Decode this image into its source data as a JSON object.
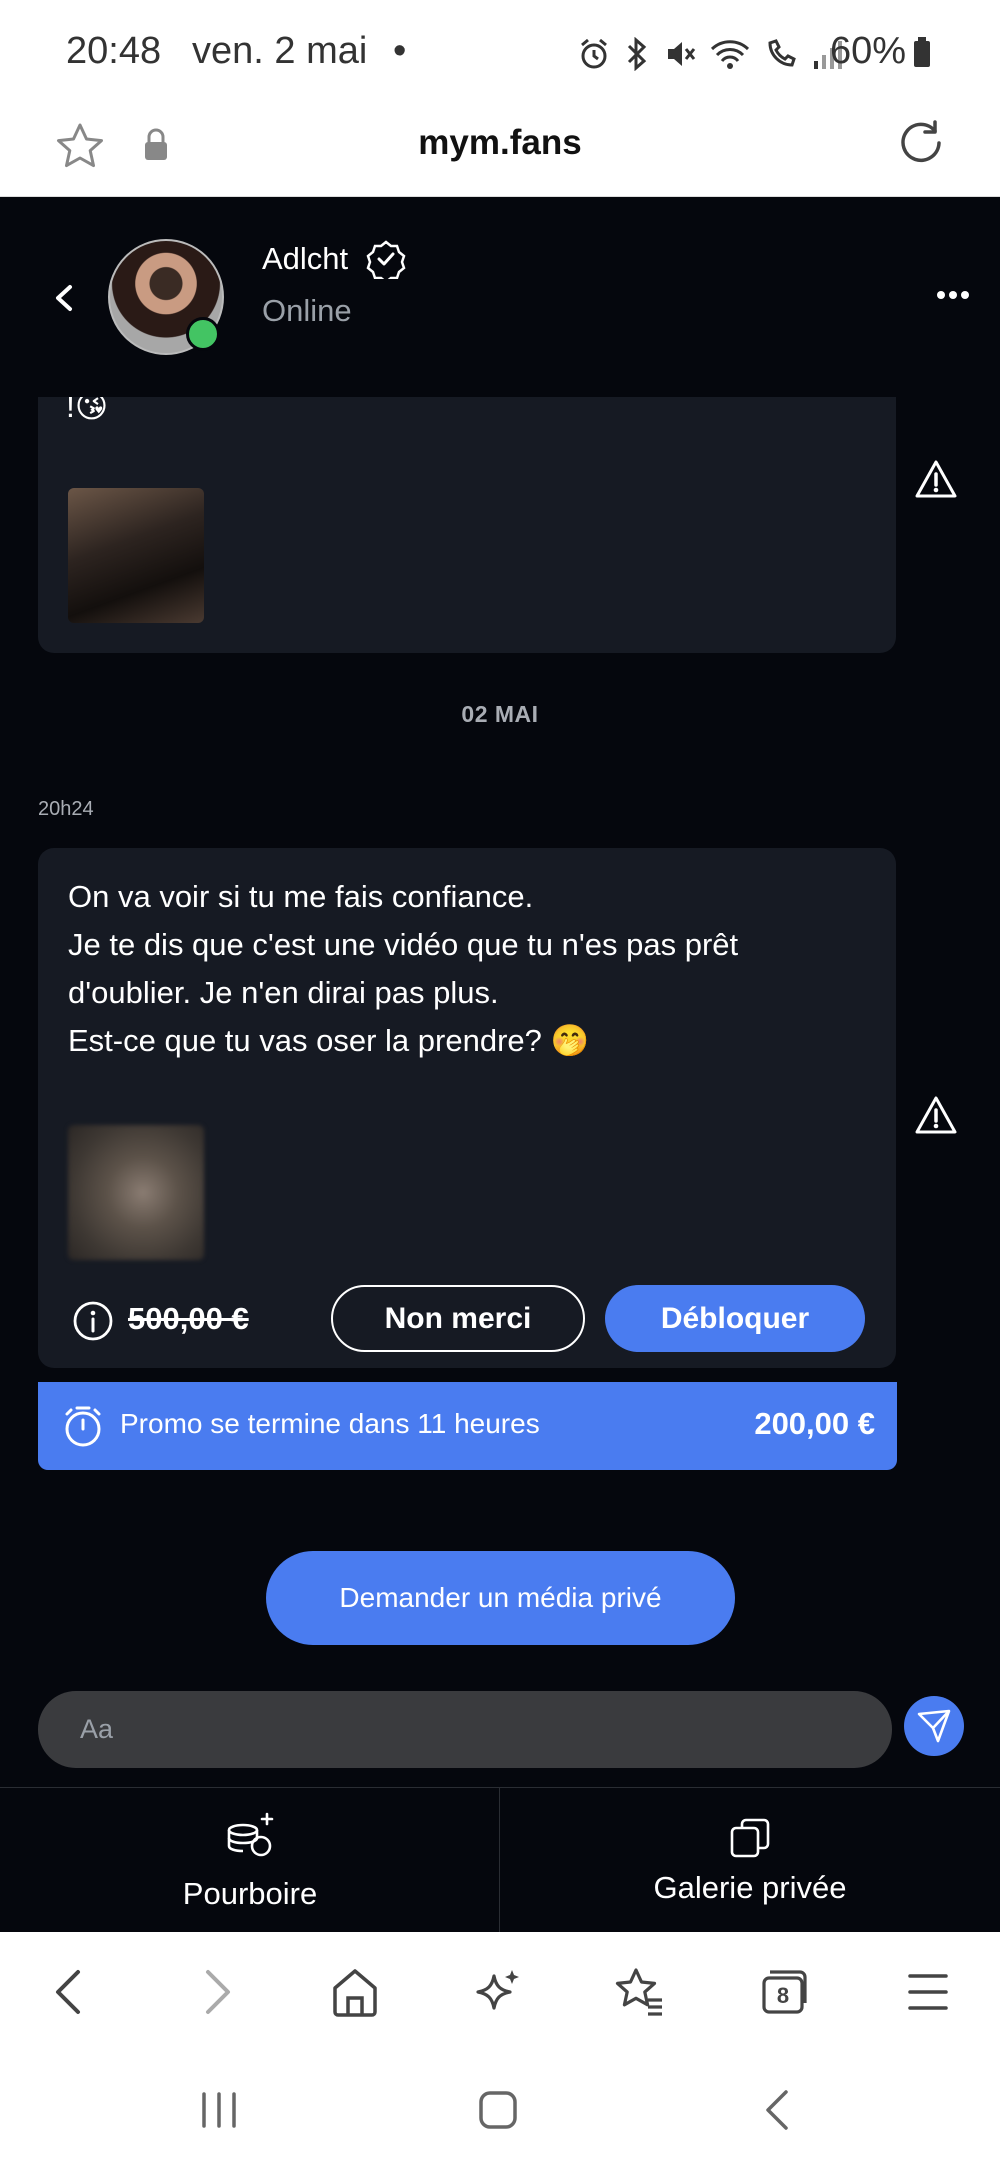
{
  "status_bar": {
    "time": "20:48",
    "date": "ven. 2 mai",
    "dot": "•",
    "battery": "60%"
  },
  "browser": {
    "url": "mym.fans"
  },
  "chat": {
    "header": {
      "username": "Adlcht",
      "status": "Online"
    },
    "earlier_message": {
      "text_tail": "!😘"
    },
    "date_separator": "02 MAI",
    "message": {
      "time": "20h24",
      "lines": [
        "On va voir si tu me fais confiance.",
        "Je te dis que c'est une vidéo que tu n'es pas prêt",
        "d'oublier. Je n'en dirai pas plus.",
        "Est-ce que tu vas oser la prendre? 🤭"
      ],
      "old_price": "500,00 €",
      "refuse_label": "Non merci",
      "unlock_label": "Débloquer"
    },
    "promo": {
      "text": "Promo se termine dans 11 heures",
      "price": "200,00 €"
    },
    "request_media_label": "Demander un média privé",
    "composer_placeholder": "Aa",
    "tabs": {
      "tip": "Pourboire",
      "gallery": "Galerie privée"
    }
  },
  "colors": {
    "accent": "#4a7cf0",
    "page_bg": "#05070d",
    "bubble_bg": "#161a23",
    "online": "#43c463"
  },
  "browser_toolbar": {
    "tabs_count": "8"
  }
}
